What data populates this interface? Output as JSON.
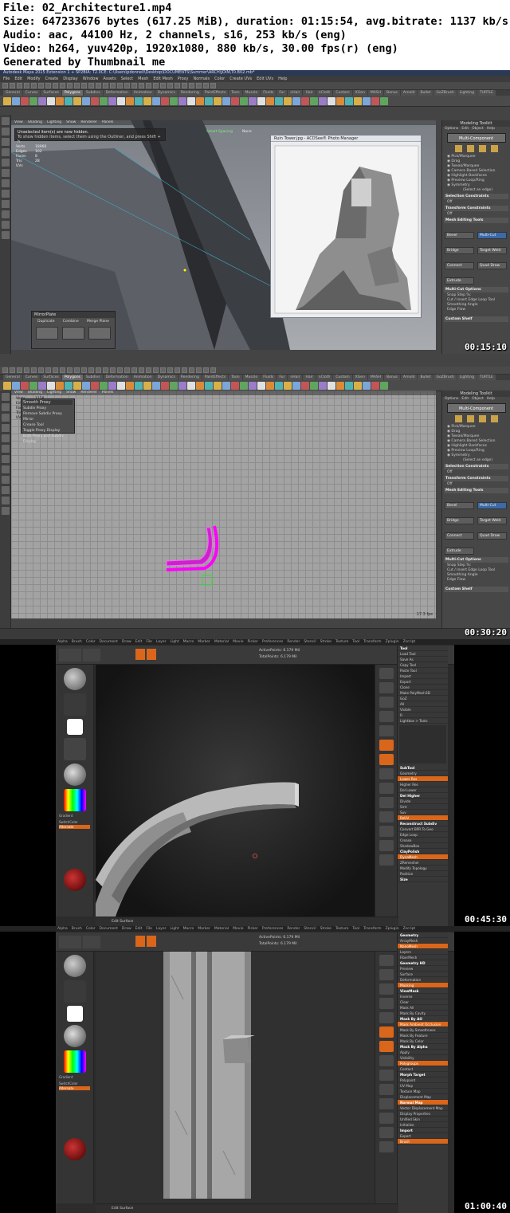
{
  "info": {
    "file": "File: 02_Architecture1.mp4",
    "size": "Size: 647233676 bytes (617.25 MiB), duration: 01:15:54, avg.bitrate: 1137 kb/s",
    "audio": "Audio: aac, 44100 Hz, 2 channels, s16, 253 kb/s (eng)",
    "video": "Video: h264, yuv420p, 1920x1080, 880 kb/s, 30.00 fps(r) (eng)",
    "generated": "Generated by Thumbnail me"
  },
  "frames": [
    {
      "timestamp": "00:15:10"
    },
    {
      "timestamp": "00:30:20"
    },
    {
      "timestamp": "00:45:30"
    },
    {
      "timestamp": "01:00:40"
    }
  ],
  "maya": {
    "title": "Autodesk Maya 2015 Extension 1 + SP2BIA: T2.0CE: C:\\Users\\pdonnell\\Desktop\\DOCUMENTS\\Summer\\ARCH\\JOIN\\T0.B02.mb*",
    "menus": [
      "File",
      "Edit",
      "Modify",
      "Create",
      "Display",
      "Window",
      "Assets",
      "Select",
      "Mesh",
      "Edit Mesh",
      "Proxy",
      "Normals",
      "Color",
      "Create UVs",
      "Edit UVs",
      "Help"
    ],
    "shelf_tabs": [
      "General",
      "Curves",
      "Surfaces",
      "Polygons",
      "Subdivs",
      "Deformation",
      "Animation",
      "Dynamics",
      "Rendering",
      "PaintEffects",
      "Toon",
      "Muscle",
      "Fluids",
      "Fur",
      "nHair",
      "Hair",
      "nCloth",
      "Custom",
      "XGen",
      "MASH",
      "Bonus",
      "Arnold",
      "Bullet",
      "GoZBrush",
      "Lighting",
      "TURTLE"
    ],
    "viewport_menus": [
      "View",
      "Shading",
      "Lighting",
      "Show",
      "Renderer",
      "Panels"
    ],
    "hidden_msg_1": "Unselected item(s) are now hidden.",
    "hidden_msg_2": "To show hidden items, select them using the Outliner, and press Shift + h.",
    "hud_labels": [
      "Verts",
      "Edges",
      "Faces",
      "Tris",
      "UVs"
    ],
    "hud_values": [
      "18960",
      "102",
      "8",
      "28"
    ],
    "smart_spacing": "Smart Spacing",
    "none": "None",
    "mirror_title": "MirrorPlate",
    "mirror_opts": [
      "Duplicate",
      "Combine",
      "Merge Plane"
    ],
    "photo_title": "Ruin Tower.jpg - ACDSee® Photo Manager",
    "right_panel": {
      "title": "Modeling Toolkit",
      "menus": [
        "Options",
        "Edit",
        "Object",
        "Help"
      ],
      "multi": "Multi-Component",
      "options": [
        "Pick/Marquee",
        "Drag",
        "Tweak/Marquee",
        "Camera Based Selection",
        "Highlight Backfaces",
        "Preview Loop/Ring",
        "Symmetry"
      ],
      "select_edge": "(Select an edge)",
      "sel_constraints": "Selection Constraints",
      "off": "Off",
      "xform_constraints": "Transform Constraints",
      "mesh_tools": "Mesh Editing Tools",
      "tools": [
        "Bevel",
        "Multi-Cut",
        "Bridge",
        "Target Weld",
        "Connect",
        "Quad Draw",
        "Extrude"
      ],
      "multi_cut_options": "Multi-Cut Options",
      "snap_step": "Snap Step %:",
      "cut_edge": "Cut / Insert Edge Loop Tool",
      "smoothing_angle": "Smoothing Angle",
      "edge_flow": "Edge Flow",
      "custom_shelf": "Custom Shelf"
    },
    "smooth_title": "Smooth Proxy",
    "smooth_items": [
      "Subdiv Proxy",
      "Remove Subdiv Proxy Mirror",
      "Crease Tool",
      "Toggle Proxy Display",
      "Both Proxy and Subdiv Display"
    ],
    "hud2_values": [
      "1128",
      "1004",
      "1128",
      "1128"
    ],
    "fps": "17.3 fps"
  },
  "zbrush": {
    "menus": [
      "Alpha",
      "Brush",
      "Color",
      "Document",
      "Draw",
      "Edit",
      "File",
      "Layer",
      "Light",
      "Macro",
      "Marker",
      "Material",
      "Movie",
      "Picker",
      "Preferences",
      "Render",
      "Stencil",
      "Stroke",
      "Texture",
      "Tool",
      "Transform",
      "Zplugin",
      "Zscript"
    ],
    "toolbar": [
      "Projection Master",
      "LightBox",
      "Quick Sketch",
      "Edit",
      "Draw",
      "Move",
      "Scale",
      "Rotate",
      "Mrgb",
      "Rgb",
      "M",
      "Zadd",
      "Zsub",
      "Zcut",
      "Focal Shift 0",
      "Draw Size 64",
      "Z Intensity 100",
      "Rgb Intensity 100"
    ],
    "active_points": "ActivePoints: 6.179 Mil",
    "total_points": "TotalPoints: 6.179 Mil",
    "tool_panel": [
      "Tool",
      "Load Tool",
      "Save As",
      "Copy Tool",
      "Paste Tool",
      "Import",
      "Export",
      "Clone",
      "Make PolyMesh3D",
      "GoZ",
      "All",
      "Visible",
      "R",
      "Lightbox > Tools"
    ],
    "right_items_3": [
      "SubTool",
      "Geometry",
      "Lower Res",
      "Higher Res",
      "Del Lower",
      "Del Higher",
      "Divide",
      "Smt",
      "Suv",
      "ReUV",
      "Reconstruct Subdiv",
      "Convert BPR To Geo",
      "Edge Loop",
      "Crease",
      "ShadowBox",
      "ClayPolish",
      "DynaMesh",
      "ZRemesher",
      "Modify Topology",
      "Position",
      "Size"
    ],
    "right_items_4": [
      "Geometry",
      "ArrayMesh",
      "NanoMesh",
      "Layers",
      "FiberMesh",
      "Geometry HD",
      "Preview",
      "Surface",
      "Deformation",
      "Masking",
      "ViewMask",
      "Inverse",
      "Clear",
      "Mask All",
      "Mask By Cavity",
      "Mask By AO",
      "Mask Ambient Occlusion",
      "Mask By Smoothness",
      "Mask By Feature",
      "Mask By Color",
      "Mask By Alpha",
      "Apply",
      "Visibility",
      "Polygroups",
      "Contact",
      "Morph Target",
      "Polypaint",
      "UV Map",
      "Texture Map",
      "Displacement Map",
      "Normal Map",
      "Vector Displacement Map",
      "Display Properties",
      "Unified Skin",
      "Initialize",
      "Import",
      "Export",
      "Brush"
    ],
    "left_labels": [
      "Gradient",
      "SwitchColor",
      "Alternate"
    ],
    "bottom_label": "Edit Surface"
  }
}
